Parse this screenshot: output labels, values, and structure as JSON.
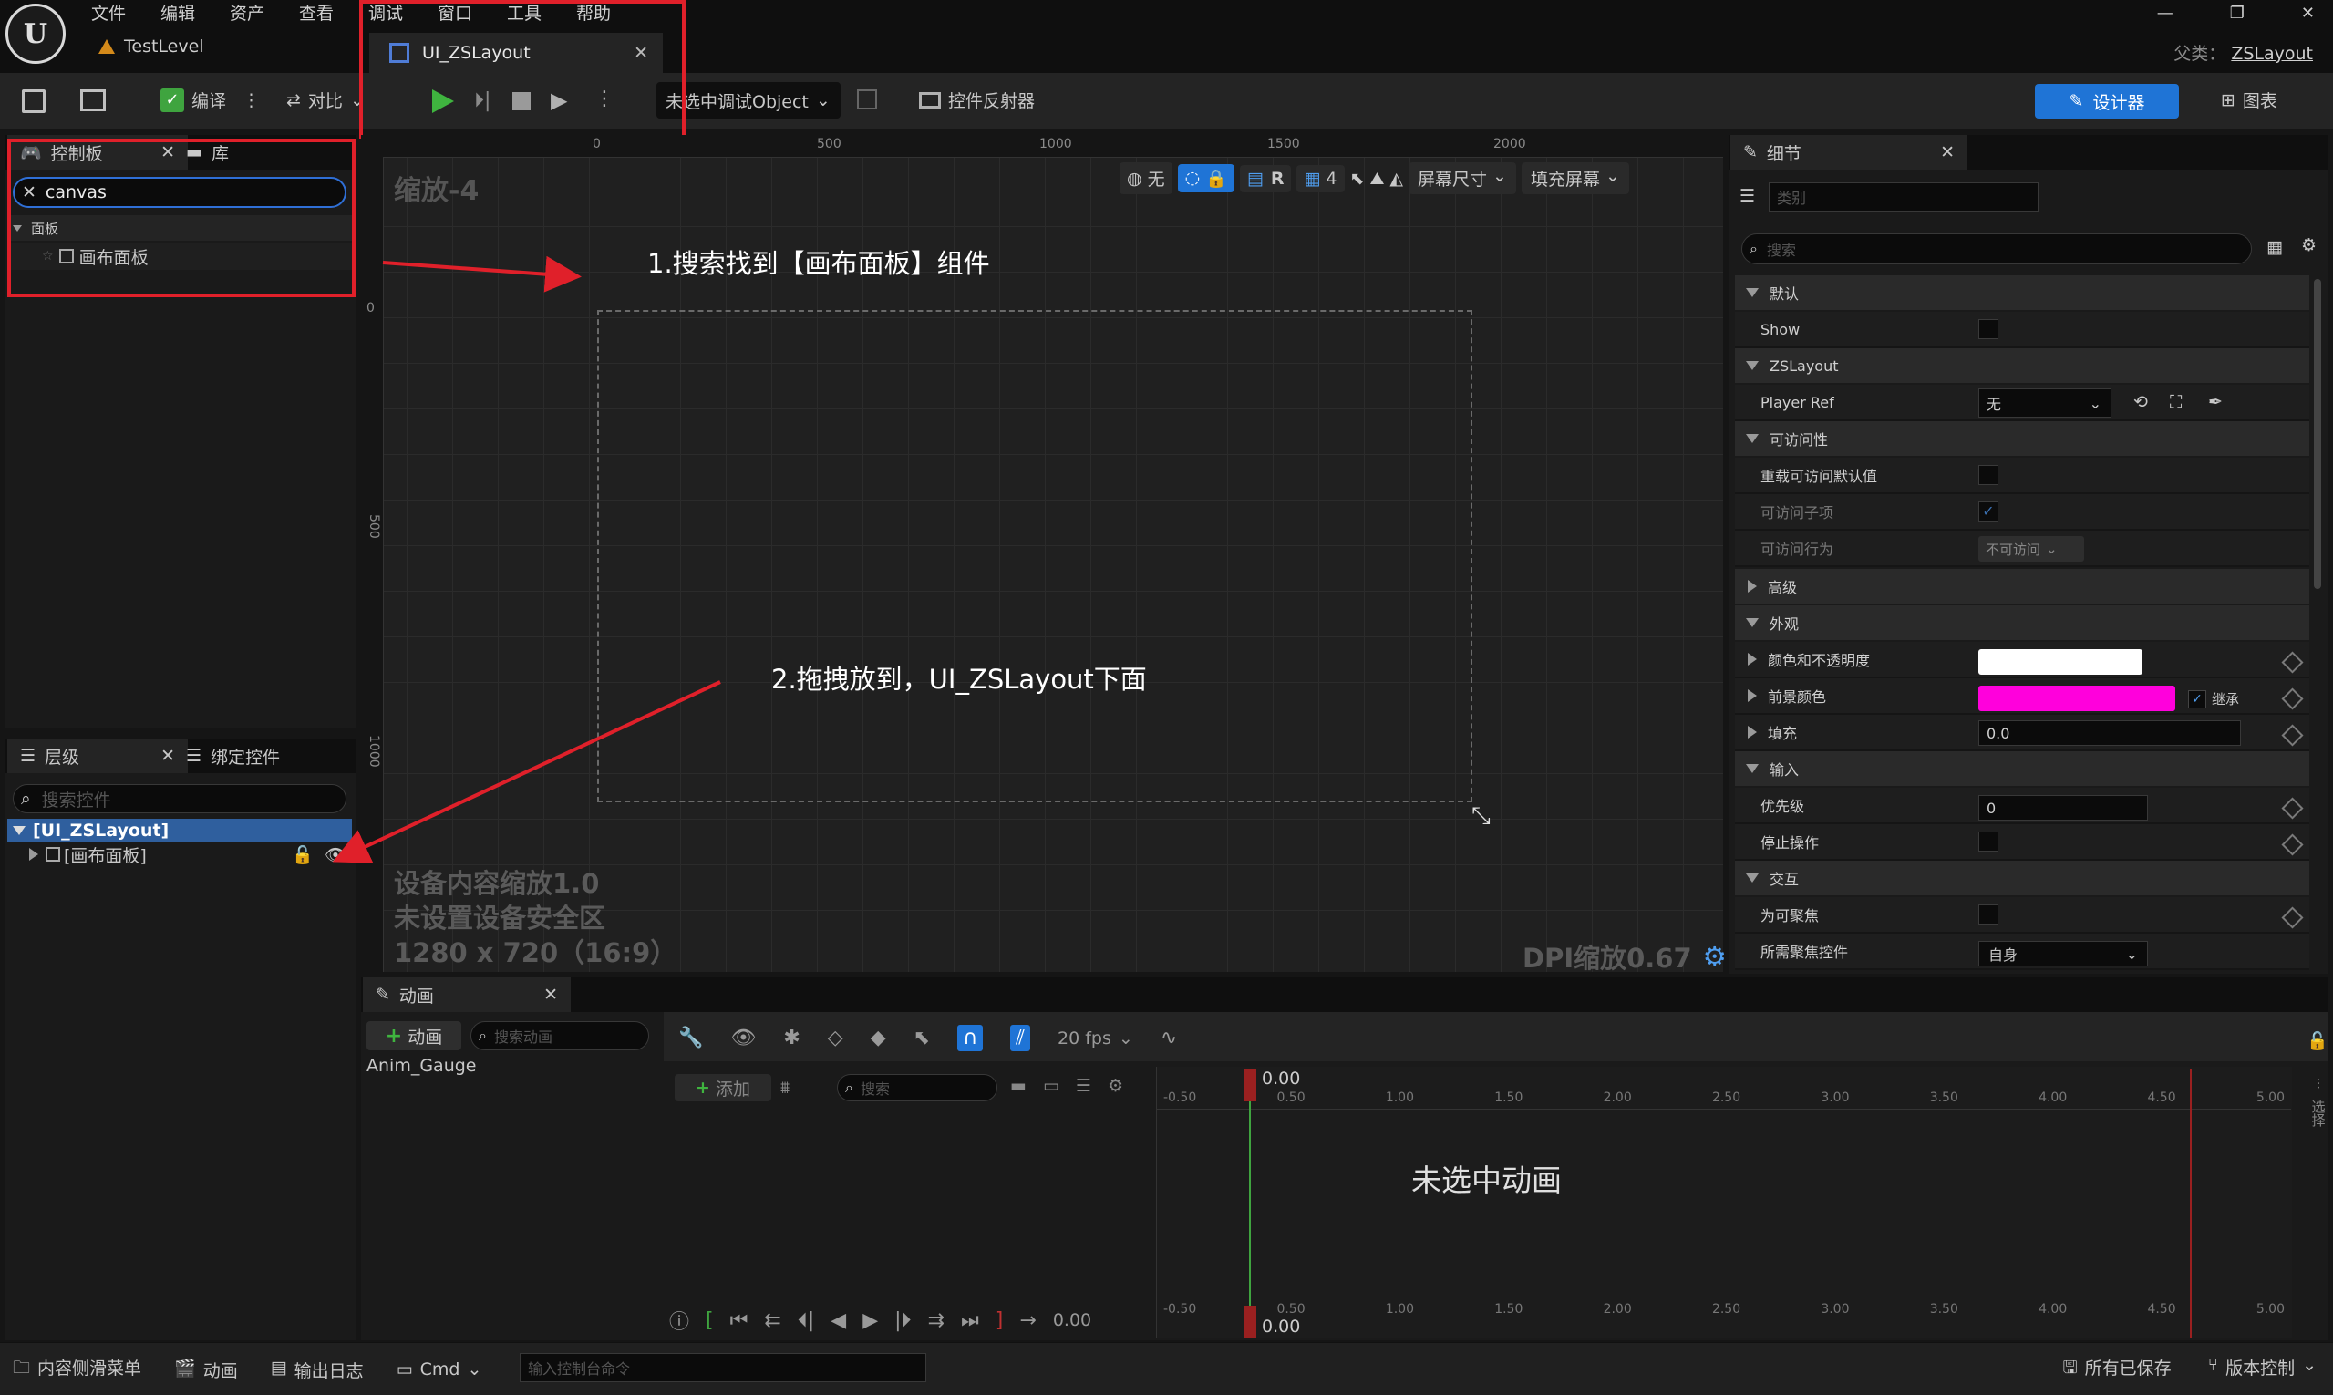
{
  "menu": [
    "文件",
    "编辑",
    "资产",
    "查看",
    "调试",
    "窗口",
    "工具",
    "帮助"
  ],
  "level_tab": "TestLevel",
  "doc_tab": "UI_ZSLayout",
  "parent_label": "父类：",
  "parent_value": "ZSLayout",
  "toolbar": {
    "compile": "编译",
    "diff": "对比",
    "debug_object": "未选中调试Object",
    "reflector": "控件反射器",
    "designer": "设计器",
    "graph": "图表"
  },
  "palette": {
    "tab": "控制板",
    "library_tab": "库",
    "search_value": "canvas",
    "category": "面板",
    "item": "画布面板"
  },
  "hierarchy": {
    "tab": "层级",
    "bind_tab": "绑定控件",
    "search_placeholder": "搜索控件",
    "root": "[UI_ZSLayout]",
    "child": "[画布面板]"
  },
  "canvas": {
    "zoom": "缩放-4",
    "ruler_ticks": [
      "0",
      "500",
      "1000",
      "1500",
      "2000"
    ],
    "vruler_ticks": [
      "0",
      "500",
      "1000"
    ],
    "toolbar_none": "无",
    "toolbar_r": "R",
    "toolbar_grid": "4",
    "screen_size": "屏幕尺寸",
    "fill_screen": "填充屏幕",
    "annotation1": "1.搜索找到【画布面板】组件",
    "annotation2": "2.拖拽放到，UI_ZSLayout下面",
    "device_scale": "设备内容缩放1.0",
    "safe_zone": "未设置设备安全区",
    "resolution": "1280 x 720（16:9）",
    "dpi": "DPI缩放0.67"
  },
  "details": {
    "tab": "细节",
    "category_placeholder": "类别",
    "search_placeholder": "搜索",
    "sections": {
      "default": "默认",
      "zslayout": "ZSLayout",
      "accessibility": "可访问性",
      "advanced": "高级",
      "appearance": "外观",
      "input": "输入",
      "interaction": "交互"
    },
    "rows": {
      "show": "Show",
      "player_ref": "Player Ref",
      "player_ref_value": "无",
      "override_access": "重载可访问默认值",
      "access_children": "可访问子项",
      "access_behavior": "可访问行为",
      "access_behavior_value": "不可访问",
      "color_opacity": "颜色和不透明度",
      "fg_color": "前景颜色",
      "inherit": "继承",
      "padding": "填充",
      "padding_value": "0.0",
      "priority": "优先级",
      "priority_value": "0",
      "stop_action": "停止操作",
      "focusable": "为可聚焦",
      "focus_widget": "所需聚焦控件",
      "focus_widget_value": "自身"
    },
    "colors": {
      "white": "#ffffff",
      "magenta": "#ff00dc"
    }
  },
  "animation": {
    "tab": "动画",
    "add_anim": "动画",
    "search_anim_placeholder": "搜索动画",
    "anim_item": "Anim_Gauge",
    "add_track": "添加",
    "track_search_placeholder": "搜索",
    "fps": "20 fps",
    "time_top": "0.00",
    "time_bottom": "0.00",
    "time_left": "0.00",
    "no_anim": "未选中动画",
    "timeline_ticks": [
      "-0.50",
      "0.50",
      "1.00",
      "1.50",
      "2.00",
      "2.50",
      "3.00",
      "3.50",
      "4.00",
      "4.50",
      "5.00"
    ],
    "side_label": "选择"
  },
  "statusbar": {
    "content_drawer": "内容侧滑菜单",
    "animation": "动画",
    "output_log": "输出日志",
    "cmd": "Cmd",
    "console_placeholder": "输入控制台命令",
    "all_saved": "所有已保存",
    "version_control": "版本控制"
  }
}
